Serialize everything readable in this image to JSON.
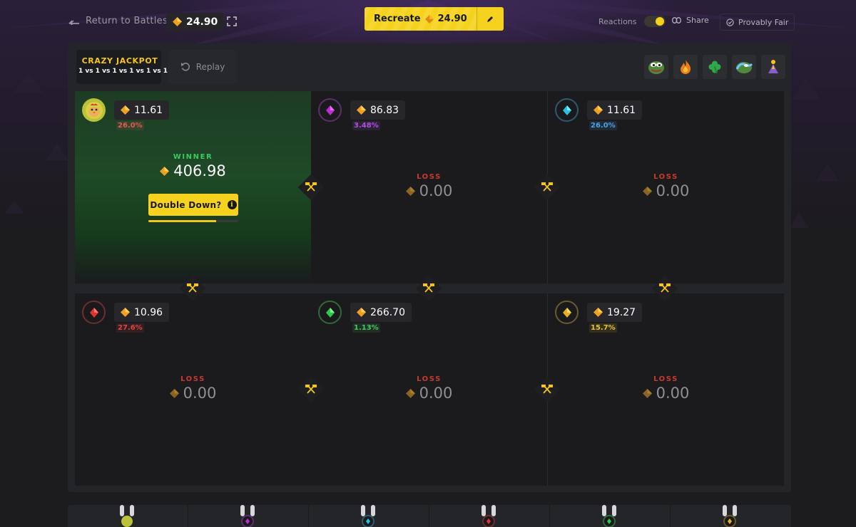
{
  "topbar": {
    "back_label": "Return to Battles",
    "battle_cost": "24.90",
    "recreate_label": "Recreate",
    "recreate_cost": "24.90",
    "reactions_label": "Reactions",
    "reactions_on": true,
    "share_label": "Share",
    "provably_fair_label": "Provably Fair"
  },
  "mode": {
    "title": "CRAZY JACKPOT",
    "subtitle": "1 vs 1 vs 1 vs 1 vs 1 vs 1"
  },
  "replay_label": "Replay",
  "reactions_bar": [
    "pepe-emoji",
    "fire-emoji",
    "clover-emoji",
    "wave-emoji",
    "pray-emoji"
  ],
  "players": [
    {
      "value": "11.61",
      "pct": "26.0%",
      "pct_color": "#e05a5a",
      "gem": "#c0392b",
      "result_label": "WINNER",
      "result_value": "406.98",
      "winner": true
    },
    {
      "value": "86.83",
      "pct": "3.48%",
      "pct_color": "#b14fe0",
      "gem": "#c02bd6",
      "result_label": "LOSS",
      "result_value": "0.00",
      "winner": false
    },
    {
      "value": "11.61",
      "pct": "26.0%",
      "pct_color": "#4aa3e8",
      "gem": "#27c0e0",
      "result_label": "LOSS",
      "result_value": "0.00",
      "winner": false
    },
    {
      "value": "10.96",
      "pct": "27.6%",
      "pct_color": "#e0443e",
      "gem": "#e0342c",
      "result_label": "LOSS",
      "result_value": "0.00",
      "winner": false
    },
    {
      "value": "266.70",
      "pct": "1.13%",
      "pct_color": "#45c85a",
      "gem": "#2ec84a",
      "result_label": "LOSS",
      "result_value": "0.00",
      "winner": false
    },
    {
      "value": "19.27",
      "pct": "15.7%",
      "pct_color": "#e8c42a",
      "gem": "#e8b020",
      "result_label": "LOSS",
      "result_value": "0.00",
      "winner": false
    }
  ],
  "double_down": {
    "label": "Double Down?",
    "progress": 0.75
  },
  "colors": {
    "accent": "#f5d21e",
    "coin": "#f0a020",
    "win_bg": "#1e4a26"
  }
}
